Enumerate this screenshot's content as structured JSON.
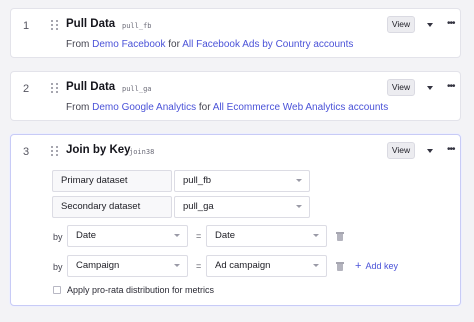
{
  "steps": [
    {
      "number": "1",
      "title": "Pull Data",
      "tag": "pull_fb",
      "desc_from": "From",
      "desc_source": "Demo Facebook",
      "desc_for": "for",
      "desc_accounts": "All Facebook Ads by Country accounts",
      "view_label": "View"
    },
    {
      "number": "2",
      "title": "Pull Data",
      "tag": "pull_ga",
      "desc_from": "From",
      "desc_source": "Demo Google Analytics",
      "desc_for": "for",
      "desc_accounts": "All Ecommerce Web Analytics accounts",
      "view_label": "View"
    },
    {
      "number": "3",
      "title": "Join by Key",
      "tag": "join38",
      "view_label": "View",
      "primary_label": "Primary dataset",
      "primary_value": "pull_fb",
      "secondary_label": "Secondary dataset",
      "secondary_value": "pull_ga",
      "keys": [
        {
          "by": "by",
          "left": "Date",
          "eq": "=",
          "right": "Date"
        },
        {
          "by": "by",
          "left": "Campaign",
          "eq": "=",
          "right": "Ad campaign"
        }
      ],
      "add_key": "Add key",
      "prorata_label": "Apply pro-rata distribution for metrics",
      "prorata_checked": false
    }
  ],
  "icons": {
    "drag": "drag-handle-icon",
    "menu_caret": "caret-down-icon",
    "more": "more-horizontal-icon",
    "delete": "trash-icon",
    "add": "plus-icon"
  },
  "colors": {
    "link": "#4a52d8",
    "active_border": "#c8cbf6"
  }
}
